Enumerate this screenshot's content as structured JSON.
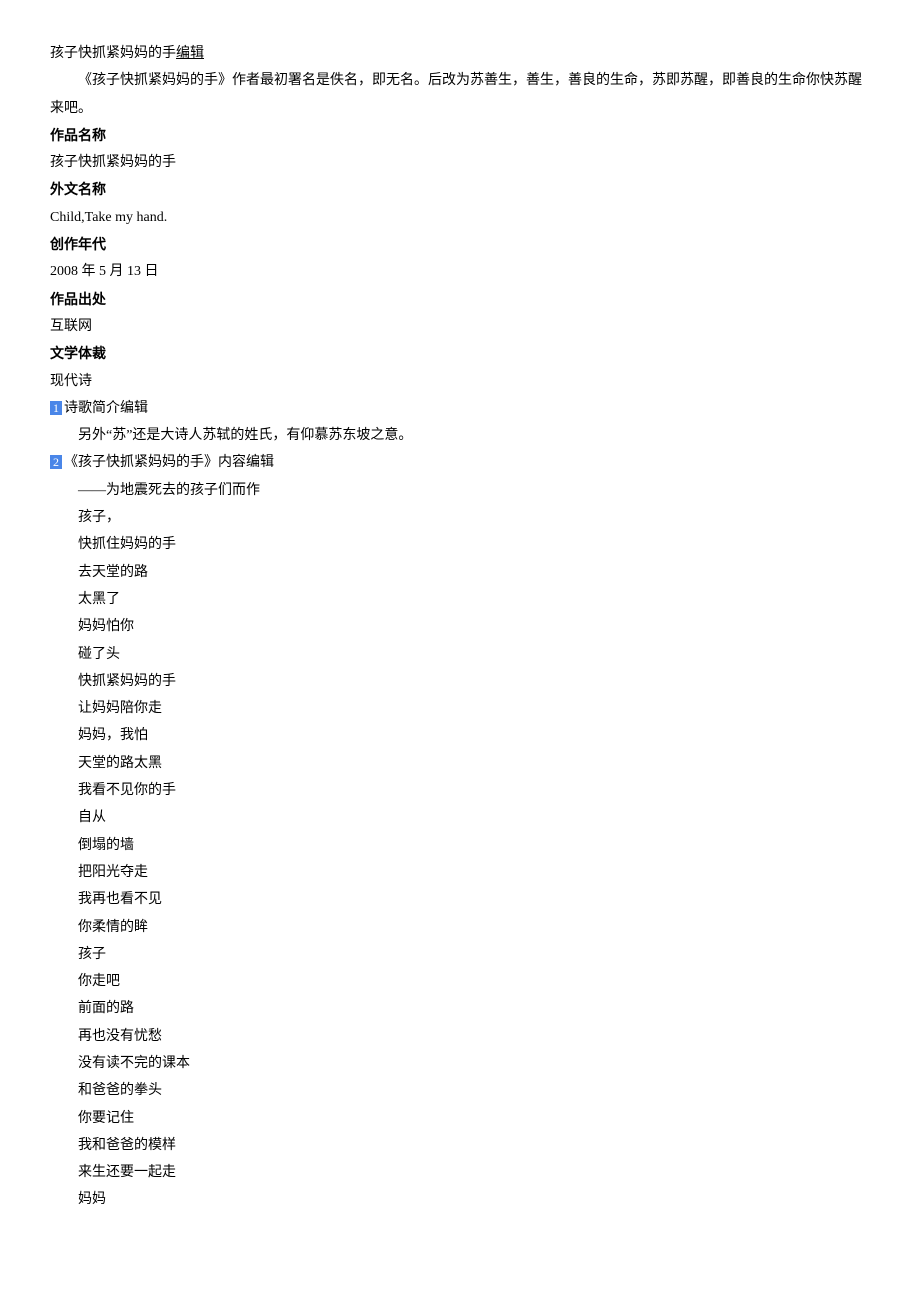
{
  "title_prefix": "孩子快抓紧妈妈的手",
  "title_edit": "编辑",
  "intro": "《孩子快抓紧妈妈的手》作者最初署名是佚名，即无名。后改为苏善生，善生，善良的生命，苏即苏醒，即善良的生命你快苏醒来吧。",
  "fields": [
    {
      "label": "作品名称",
      "value": "孩子快抓紧妈妈的手"
    },
    {
      "label": "外文名称",
      "value": "Child,Take my hand."
    },
    {
      "label": "创作年代",
      "value": "2008 年 5 月 13 日"
    },
    {
      "label": "作品出处",
      "value": "互联网"
    },
    {
      "label": "文学体裁",
      "value": "现代诗"
    }
  ],
  "sections": [
    {
      "num": "1",
      "title": "诗歌简介编辑",
      "lines": [
        "另外“苏”还是大诗人苏轼的姓氏，有仰慕苏东坡之意。"
      ]
    },
    {
      "num": "2",
      "title": "《孩子快抓紧妈妈的手》内容编辑",
      "lines": [
        "——为地震死去的孩子们而作",
        "孩子，",
        "快抓住妈妈的手",
        "去天堂的路",
        "太黑了",
        "妈妈怕你",
        "碰了头",
        "快抓紧妈妈的手",
        "让妈妈陪你走",
        "妈妈，我怕",
        "天堂的路太黑",
        "我看不见你的手",
        "自从",
        "倒塌的墙",
        "把阳光夺走",
        "我再也看不见",
        "你柔情的眸",
        "孩子",
        "你走吧",
        "前面的路",
        "再也没有忧愁",
        "没有读不完的课本",
        "和爸爸的拳头",
        "你要记住",
        "我和爸爸的模样",
        "来生还要一起走",
        "妈妈"
      ]
    }
  ]
}
